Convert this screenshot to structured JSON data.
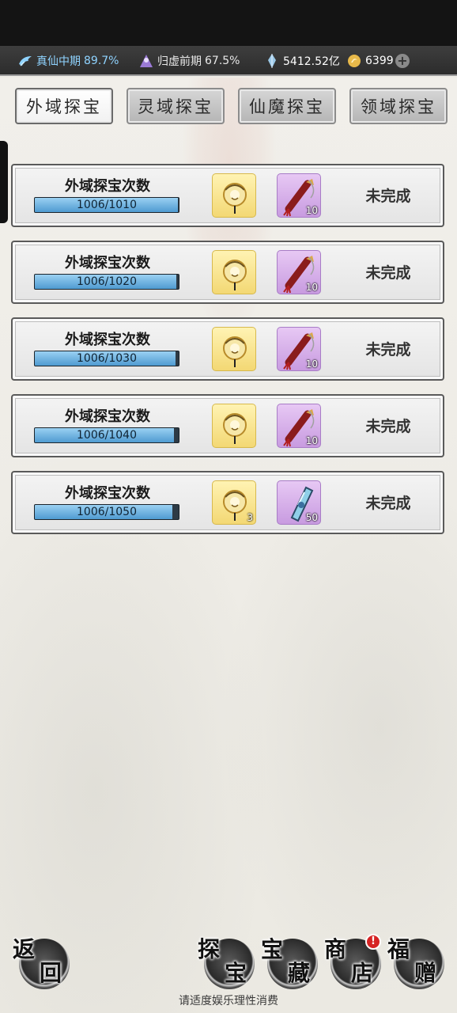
{
  "header": {
    "realm_primary": {
      "name": "真仙中期",
      "percent": "89.7%",
      "icon": "wing-icon"
    },
    "realm_secondary": {
      "name": "归虚前期",
      "percent": "67.5%",
      "icon": "spirit-icon"
    },
    "currency_crystal": {
      "value": "5412.52亿",
      "icon": "crystal-icon"
    },
    "currency_gold": {
      "value": "6399",
      "icon": "coin-icon"
    },
    "plus_label": "+"
  },
  "tabs": [
    {
      "label": "外域探宝",
      "active": true
    },
    {
      "label": "灵域探宝",
      "active": false
    },
    {
      "label": "仙魔探宝",
      "active": false
    },
    {
      "label": "领域探宝",
      "active": false
    }
  ],
  "tasks": [
    {
      "title": "外域探宝次数",
      "progress_text": "1006/1010",
      "progress": 0.996,
      "reward1": {
        "icon": "lantern-icon",
        "count": ""
      },
      "reward2": {
        "icon": "scroll-tassel-icon",
        "count": "10"
      },
      "status": "未完成"
    },
    {
      "title": "外域探宝次数",
      "progress_text": "1006/1020",
      "progress": 0.986,
      "reward1": {
        "icon": "lantern-icon",
        "count": ""
      },
      "reward2": {
        "icon": "scroll-tassel-icon",
        "count": "10"
      },
      "status": "未完成"
    },
    {
      "title": "外域探宝次数",
      "progress_text": "1006/1030",
      "progress": 0.977,
      "reward1": {
        "icon": "lantern-icon",
        "count": ""
      },
      "reward2": {
        "icon": "scroll-tassel-icon",
        "count": "10"
      },
      "status": "未完成"
    },
    {
      "title": "外域探宝次数",
      "progress_text": "1006/1040",
      "progress": 0.967,
      "reward1": {
        "icon": "lantern-icon",
        "count": ""
      },
      "reward2": {
        "icon": "scroll-tassel-icon",
        "count": "10"
      },
      "status": "未完成"
    },
    {
      "title": "外域探宝次数",
      "progress_text": "1006/1050",
      "progress": 0.958,
      "reward1": {
        "icon": "lantern-icon",
        "count": "3"
      },
      "reward2": {
        "icon": "crystal-shard-icon",
        "count": "50"
      },
      "status": "未完成"
    }
  ],
  "nav": {
    "back": {
      "c1": "返",
      "c2": "回"
    },
    "explore": {
      "c1": "探",
      "c2": "宝"
    },
    "treasure": {
      "c1": "宝",
      "c2": "藏"
    },
    "shop": {
      "c1": "商",
      "c2": "店",
      "badge": "!"
    },
    "gift": {
      "c1": "福",
      "c2": "赠"
    }
  },
  "notice": "请适度娱乐理性消费",
  "colors": {
    "progress_fill": "#4f9bd1",
    "realm_primary": "#8fd3ff",
    "badge": "#d62424"
  }
}
